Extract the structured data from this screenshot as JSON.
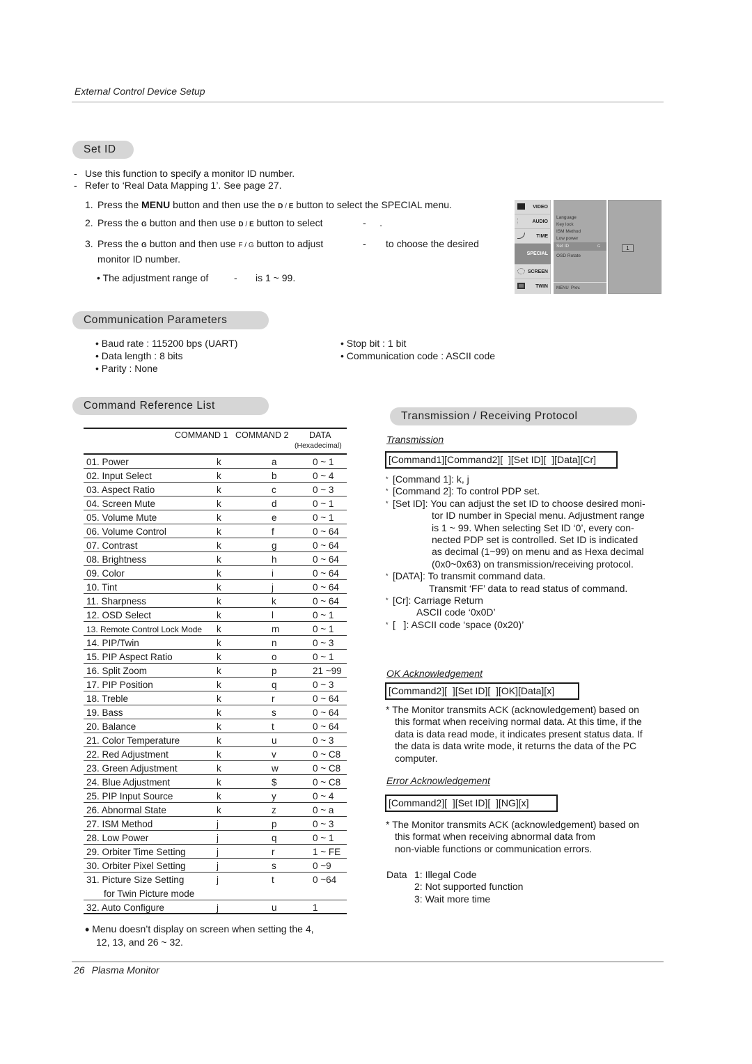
{
  "header": {
    "running_title": "External Control Device Setup"
  },
  "footer": {
    "page_number": "26",
    "title": "Plasma Monitor"
  },
  "set_id": {
    "title": "Set ID",
    "bullets": [
      "Use this function to specify a monitor ID number.",
      "Refer to ‘Real Data Mapping 1’. See page 27."
    ],
    "steps": [
      {
        "num": "1.",
        "pre": "Press the ",
        "bold": "MENU",
        "mid": " button and then use the ",
        "key1": "D",
        "sep": " / ",
        "key2": "E",
        "post": "  button to select the SPECIAL menu."
      },
      {
        "num": "2.",
        "pre": "Press the ",
        "key0": "G",
        "mid": " button and then use ",
        "key1": "D",
        "sep": " / ",
        "key2": "E",
        "post": "  button to select",
        "tail": "-     ."
      },
      {
        "num": "3.",
        "pre": "Press the ",
        "key0": "G",
        "mid": " button and then use ",
        "key1": "F",
        "sep": " / ",
        "key2": "G",
        "post": " button to adjust",
        "tail": "-",
        "tail2": "to choose the desired",
        "line2": "monitor ID number."
      }
    ],
    "range_note": {
      "pre": "• The adjustment range of",
      "dash": "-",
      "post": "is 1 ~ 99."
    }
  },
  "osd_menu": {
    "tabs": [
      {
        "label": "VIDEO",
        "icon": "video-icon"
      },
      {
        "label": "AUDIO",
        "icon": "audio-icon"
      },
      {
        "label": "TIME",
        "icon": "time-icon"
      },
      {
        "label": "SPECIAL",
        "icon": "special-icon",
        "active": true
      },
      {
        "label": "SCREEN",
        "icon": "screen-icon"
      },
      {
        "label": "TWIN",
        "icon": "twin-icon"
      }
    ],
    "items": [
      "Language",
      "Key lock",
      "ISM Method",
      "Low power"
    ],
    "selected_item": "Set ID",
    "selected_arrow": "G",
    "items_after": [
      "OSD Rotate"
    ],
    "footer_key": "MENU",
    "footer_label": "Prev.",
    "value": "1"
  },
  "communication": {
    "title": "Communication Parameters",
    "left": [
      "• Baud rate : 115200 bps (UART)",
      "• Data length : 8 bits",
      "• Parity : None"
    ],
    "right": [
      "• Stop bit : 1 bit",
      "• Communication code : ASCII code"
    ]
  },
  "command_list": {
    "title": "Command Reference List",
    "columns": {
      "command1": "COMMAND 1",
      "command2": "COMMAND 2",
      "data": "DATA",
      "data_sub": "(Hexadecimal)"
    },
    "rows": [
      {
        "name": "01. Power",
        "c1": "k",
        "c2": "a",
        "data": "0 ~ 1"
      },
      {
        "name": "02. Input Select",
        "c1": "k",
        "c2": "b",
        "data": "0 ~ 4"
      },
      {
        "name": "03. Aspect Ratio",
        "c1": "k",
        "c2": "c",
        "data": "0 ~ 3"
      },
      {
        "name": "04. Screen Mute",
        "c1": "k",
        "c2": "d",
        "data": "0 ~ 1"
      },
      {
        "name": "05. Volume Mute",
        "c1": "k",
        "c2": "e",
        "data": "0 ~ 1"
      },
      {
        "name": "06. Volume Control",
        "c1": "k",
        "c2": "f",
        "data": "0 ~ 64"
      },
      {
        "name": "07. Contrast",
        "c1": "k",
        "c2": "g",
        "data": "0 ~ 64"
      },
      {
        "name": "08. Brightness",
        "c1": "k",
        "c2": "h",
        "data": "0 ~ 64"
      },
      {
        "name": "09. Color",
        "c1": "k",
        "c2": "i",
        "data": "0 ~ 64"
      },
      {
        "name": "10. Tint",
        "c1": "k",
        "c2": "j",
        "data": "0 ~ 64"
      },
      {
        "name": "11. Sharpness",
        "c1": "k",
        "c2": "k",
        "data": "0 ~ 64"
      },
      {
        "name": "12. OSD Select",
        "c1": "k",
        "c2": "l",
        "data": "0 ~ 1"
      },
      {
        "name": "13. Remote Control Lock Mode",
        "c1": "k",
        "c2": "m",
        "data": "0 ~ 1",
        "small": true
      },
      {
        "name": "14. PIP/Twin",
        "c1": "k",
        "c2": "n",
        "data": "0 ~ 3"
      },
      {
        "name": "15. PIP Aspect Ratio",
        "c1": "k",
        "c2": "o",
        "data": "0 ~ 1"
      },
      {
        "name": "16. Split Zoom",
        "c1": "k",
        "c2": "p",
        "data": "21 ~99"
      },
      {
        "name": "17. PIP Position",
        "c1": "k",
        "c2": "q",
        "data": "0 ~ 3"
      },
      {
        "name": "18. Treble",
        "c1": "k",
        "c2": "r",
        "data": "0 ~ 64"
      },
      {
        "name": "19. Bass",
        "c1": "k",
        "c2": "s",
        "data": "0 ~ 64"
      },
      {
        "name": "20. Balance",
        "c1": "k",
        "c2": "t",
        "data": "0 ~ 64"
      },
      {
        "name": "21. Color Temperature",
        "c1": "k",
        "c2": "u",
        "data": "0 ~ 3"
      },
      {
        "name": "22. Red Adjustment",
        "c1": "k",
        "c2": "v",
        "data": "0 ~ C8"
      },
      {
        "name": "23. Green Adjustment",
        "c1": "k",
        "c2": "w",
        "data": "0 ~ C8"
      },
      {
        "name": "24. Blue Adjustment",
        "c1": "k",
        "c2": "$",
        "data": "0 ~ C8"
      },
      {
        "name": "25. PIP Input Source",
        "c1": "k",
        "c2": "y",
        "data": "0 ~ 4"
      },
      {
        "name": "26. Abnormal State",
        "c1": "k",
        "c2": "z",
        "data": "0 ~ a"
      },
      {
        "name": "27. ISM Method",
        "c1": "j",
        "c2": "p",
        "data": "0 ~ 3"
      },
      {
        "name": "28. Low Power",
        "c1": "j",
        "c2": "q",
        "data": "0 ~ 1"
      },
      {
        "name": "29. Orbiter Time Setting",
        "c1": "j",
        "c2": "r",
        "data": "1 ~ FE"
      },
      {
        "name": "30. Orbiter Pixel Setting",
        "c1": "j",
        "c2": "s",
        "data": "0 ~9"
      },
      {
        "name": "31. Picture Size Setting",
        "sub": "for Twin Picture mode",
        "c1": "j",
        "c2": "t",
        "data": "0 ~64"
      },
      {
        "name": "32. Auto Configure",
        "c1": "j",
        "c2": "u",
        "data": "1"
      }
    ],
    "note": [
      "Menu doesn’t display on screen when setting the 4,",
      "12, 13, and 26 ~ 32."
    ]
  },
  "protocol": {
    "title": "Transmission / Receiving  Protocol",
    "transmission": {
      "heading": "Transmission",
      "format": "[Command1][Command2][  ][Set ID][  ][Data][Cr]",
      "notes": [
        "[Command 1]: k, j",
        "[Command 2]: To control PDP set.",
        "[Set ID]: You can adjust the set ID to choose desired moni-",
        "tor ID number in Special menu. Adjustment range",
        "is 1 ~ 99. When selecting Set ID ‘0’, every con-",
        "nected PDP set is controlled. Set ID is indicated",
        "as decimal (1~99) on menu and as Hexa decimal",
        "(0x0~0x63) on transmission/receiving protocol.",
        "[DATA]: To transmit command data.",
        "Transmit ‘FF’ data to read status of command.",
        "[Cr]: Carriage Return",
        "ASCII code ‘0x0D’",
        "[   ]: ASCII code ‘space (0x20)’"
      ]
    },
    "ok_ack": {
      "heading": "OK Acknowledgement",
      "format": "[Command2][  ][Set ID][  ][OK][Data][x]",
      "note": [
        "* The Monitor transmits ACK (acknowledgement) based on",
        "this format when receiving normal data. At this time, if the",
        "data is data read mode, it indicates present status data. If",
        "the data is data write mode, it returns the data of the PC",
        "computer."
      ]
    },
    "error_ack": {
      "heading": "Error Acknowledgement",
      "format": "[Command2][  ][Set ID][  ][NG][x]",
      "note": [
        "* The Monitor transmits ACK (acknowledgement) based on",
        "this format when receiving abnormal data from",
        "non-viable functions or communication errors."
      ],
      "data_label": "Data",
      "codes": [
        "1: Illegal Code",
        "2: Not supported function",
        "3: Wait more time"
      ]
    }
  }
}
